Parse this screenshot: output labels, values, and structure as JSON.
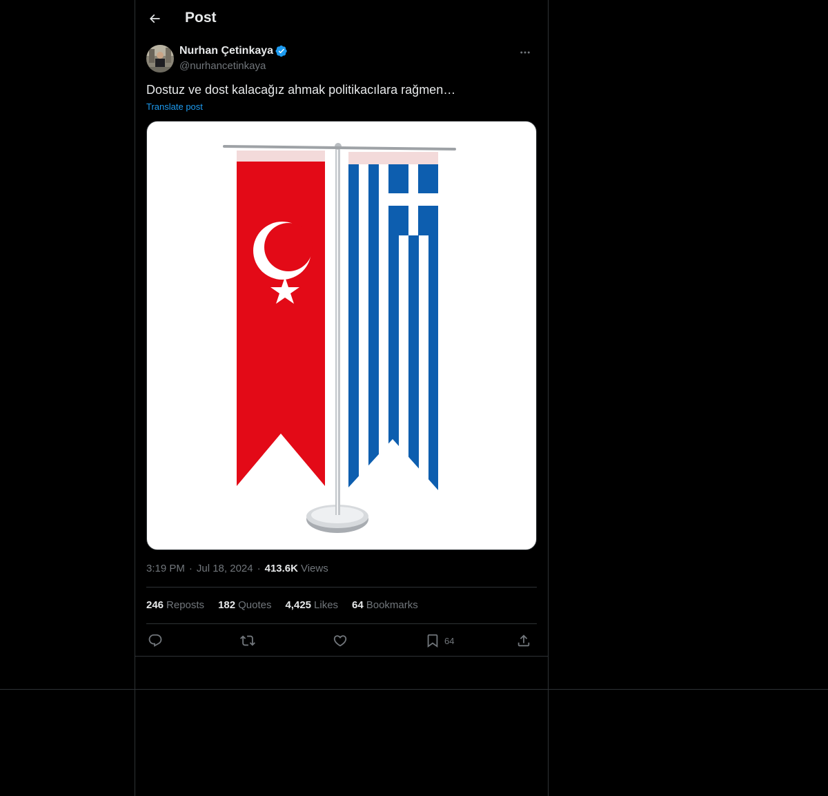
{
  "header": {
    "title": "Post"
  },
  "post": {
    "author": {
      "display_name": "Nurhan Çetinkaya",
      "handle": "@nurhancetinkaya",
      "verified": true
    },
    "text": "Dostuz ve dost kalacağız ahmak politikacılara rağmen…",
    "translate_label": "Translate post",
    "media": {
      "flags": [
        "turkey-flag",
        "greece-flag"
      ]
    },
    "time": "3:19 PM",
    "date": "Jul 18, 2024",
    "views_count": "413.6K",
    "views_label": "Views",
    "stats": {
      "reposts": {
        "count": "246",
        "label": "Reposts"
      },
      "quotes": {
        "count": "182",
        "label": "Quotes"
      },
      "likes": {
        "count": "4,425",
        "label": "Likes"
      },
      "bookmarks": {
        "count": "64",
        "label": "Bookmarks"
      }
    },
    "actions": {
      "bookmark_count": "64"
    }
  },
  "colors": {
    "background": "#000000",
    "border": "#2f3336",
    "text_primary": "#e7e9ea",
    "text_secondary": "#71767b",
    "accent": "#1d9bf0",
    "turkey_red": "#e30a17",
    "greece_blue": "#0d5eaf"
  },
  "icons": [
    "back-arrow-icon",
    "verified-badge-icon",
    "more-icon",
    "reply-icon",
    "repost-icon",
    "like-icon",
    "bookmark-icon",
    "share-icon"
  ]
}
